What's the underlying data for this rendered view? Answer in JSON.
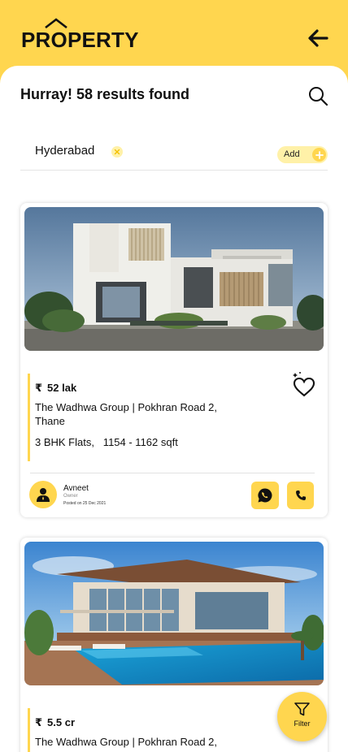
{
  "header": {
    "logo_text": "PROPERTY",
    "brand_color": "#ffd64f",
    "back_icon": "arrow-left-icon"
  },
  "search": {
    "results_text": "Hurray! 58 results found",
    "search_icon": "search-icon"
  },
  "location_filter": {
    "chip_label": "Hyderabad",
    "add_label": "Add"
  },
  "listings": [
    {
      "currency": "₹",
      "price": "52 lak",
      "title": "The Wadhwa Group | Pokhran Road 2, Thane",
      "specs": "3 BHK Flats,   1154 - 1162 sqft",
      "owner_name": "Avneet",
      "owner_role": "Owner",
      "posted": "Posted on 25 Dec 2021"
    },
    {
      "currency": "₹",
      "price": "5.5 cr",
      "title": "The Wadhwa Group | Pokhran Road 2,"
    }
  ],
  "fab": {
    "label": "Filter"
  }
}
